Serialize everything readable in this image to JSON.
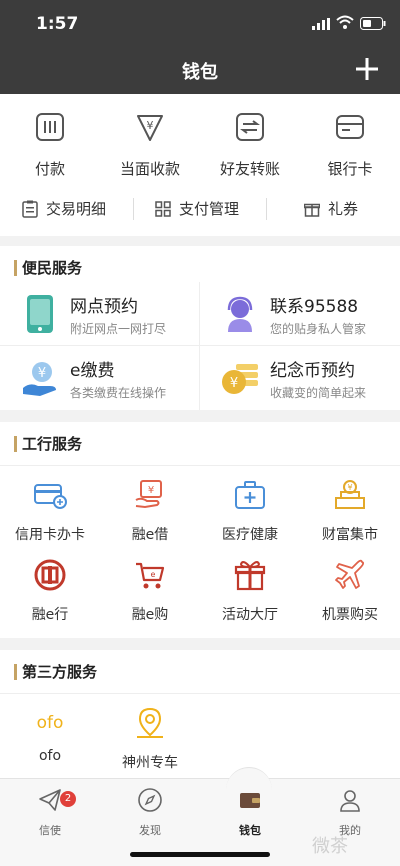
{
  "status": {
    "time": "1:57"
  },
  "header": {
    "title": "钱包"
  },
  "quick": [
    {
      "label": "付款",
      "icon": "pay-icon"
    },
    {
      "label": "当面收款",
      "icon": "receive-icon"
    },
    {
      "label": "好友转账",
      "icon": "transfer-icon"
    },
    {
      "label": "银行卡",
      "icon": "bank-card-icon"
    }
  ],
  "sub": [
    {
      "label": "交易明细",
      "icon": "clipboard-icon"
    },
    {
      "label": "支付管理",
      "icon": "grid-icon"
    },
    {
      "label": "礼券",
      "icon": "gift-icon"
    }
  ],
  "bianmin": {
    "title": "便民服务",
    "items": [
      {
        "title": "网点预约",
        "sub": "附近网点一网打尽",
        "icon": "phone-icon"
      },
      {
        "title": "联系95588",
        "sub": "您的贴身私人管家",
        "icon": "service-agent-icon"
      },
      {
        "title": "e缴费",
        "sub": "各类缴费在线操作",
        "icon": "payment-hand-icon"
      },
      {
        "title": "纪念币预约",
        "sub": "收藏变的简单起来",
        "icon": "coin-icon"
      }
    ]
  },
  "gonghang": {
    "title": "工行服务",
    "items": [
      {
        "label": "信用卡办卡",
        "icon": "credit-card-icon"
      },
      {
        "label": "融e借",
        "icon": "loan-icon"
      },
      {
        "label": "医疗健康",
        "icon": "medical-kit-icon"
      },
      {
        "label": "财富集市",
        "icon": "wealth-icon"
      },
      {
        "label": "融e行",
        "icon": "icbc-logo-icon"
      },
      {
        "label": "融e购",
        "icon": "shopping-cart-icon"
      },
      {
        "label": "活动大厅",
        "icon": "gift-box-icon"
      },
      {
        "label": "机票购买",
        "icon": "airplane-icon"
      }
    ]
  },
  "third": {
    "title": "第三方服务",
    "items": [
      {
        "label": "ofo",
        "logo": "ofo",
        "icon": "ofo-logo-icon"
      },
      {
        "label": "神州专车",
        "icon": "location-pin-icon"
      }
    ]
  },
  "nav": [
    {
      "label": "信使",
      "icon": "paper-plane-icon",
      "badge": "2"
    },
    {
      "label": "发现",
      "icon": "compass-icon"
    },
    {
      "label": "钱包",
      "icon": "wallet-icon",
      "active": true
    },
    {
      "label": "我的",
      "icon": "user-icon"
    }
  ],
  "watermark": "微茶",
  "colors": {
    "header_bg": "#3c3c3c",
    "accent": "#c5a364",
    "icbc_red": "#c0392b",
    "badge": "#e0403a"
  }
}
